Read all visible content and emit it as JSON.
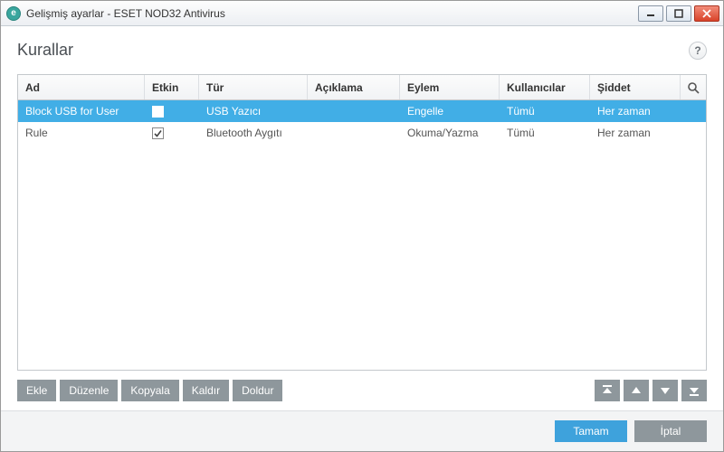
{
  "window": {
    "title": "Gelişmiş ayarlar - ESET NOD32 Antivirus"
  },
  "heading": "Kurallar",
  "help_label": "?",
  "columns": {
    "ad": "Ad",
    "etkin": "Etkin",
    "tur": "Tür",
    "aciklama": "Açıklama",
    "eylem": "Eylem",
    "kullanicilar": "Kullanıcılar",
    "siddet": "Şiddet"
  },
  "rows": [
    {
      "ad": "Block USB for User",
      "etkin": true,
      "tur": "USB Yazıcı",
      "aciklama": "",
      "eylem": "Engelle",
      "kullanicilar": "Tümü",
      "siddet": "Her zaman",
      "selected": true
    },
    {
      "ad": "Rule",
      "etkin": true,
      "tur": "Bluetooth Aygıtı",
      "aciklama": "",
      "eylem": "Okuma/Yazma",
      "kullanicilar": "Tümü",
      "siddet": "Her zaman",
      "selected": false
    }
  ],
  "actions": {
    "ekle": "Ekle",
    "duzenle": "Düzenle",
    "kopyala": "Kopyala",
    "kaldir": "Kaldır",
    "doldur": "Doldur"
  },
  "footer": {
    "ok": "Tamam",
    "cancel": "İptal"
  },
  "colors": {
    "selection": "#41aee6",
    "primary_button": "#3ea2dc",
    "secondary_button": "#8e979c"
  }
}
